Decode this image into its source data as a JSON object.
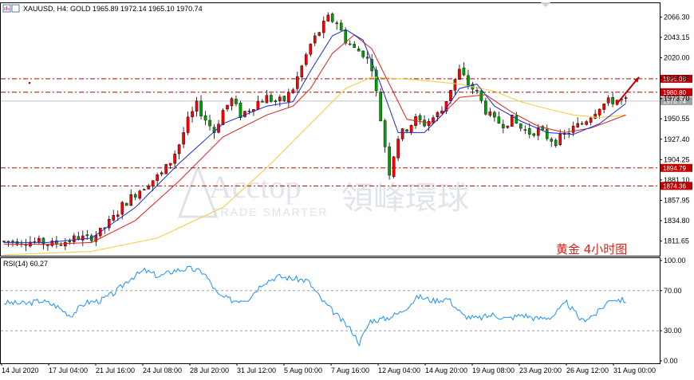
{
  "header": {
    "symbol_text": "XAUUSD, H4:  GOLD  1965.89 1972.14 1965.10 1970.74"
  },
  "caption": "黄金    4小时图",
  "watermark": {
    "brand": "Acctop",
    "tagline": "TRADE SMARTER",
    "chinese": "領峰環球"
  },
  "rsi_panel": {
    "title": "RSI(14) 60.27"
  },
  "colors": {
    "bull": "#ff0000",
    "bear": "#00a000",
    "wick": "#000000",
    "ma_fast": "#1a2ad6",
    "ma_mid": "#e0201a",
    "ma_slow": "#f0d048",
    "rsi": "#1e90ff",
    "level_line": "#c00000",
    "level_tag": "#c00000",
    "price_tag": "#a0a0a0"
  },
  "chart_data": [
    {
      "type": "candlestick",
      "title": "XAUUSD, H4",
      "ylim": [
        1795,
        2082
      ],
      "y_ticks": [
        "2066.30",
        "2043.15",
        "2020.00",
        "1996.85",
        "1973.70",
        "1950.55",
        "1927.40",
        "1904.25",
        "1881.10",
        "1857.95",
        "1834.80",
        "1811.65"
      ],
      "x_ticks": [
        "14 Jul 2020",
        "17 Jul 04:00",
        "21 Jul 16:00",
        "24 Jul 08:00",
        "28 Jul 20:00",
        "31 Jul 12:00",
        "5 Aug 00:00",
        "7 Aug 16:00",
        "12 Aug 04:00",
        "14 Aug 20:00",
        "19 Aug 08:00",
        "23 Aug 20:00",
        "26 Aug 12:00",
        "31 Aug 00:00"
      ],
      "levels": [
        {
          "value": 1996.08,
          "label": "1996.08"
        },
        {
          "value": 1980.8,
          "label": "1980.80"
        },
        {
          "value": 1894.79,
          "label": "1894.79"
        },
        {
          "value": 1874.36,
          "label": "1874.36"
        }
      ],
      "current_price": {
        "value": 1970.74,
        "label": "1970.74"
      },
      "price_path": [
        [
          0,
          1811
        ],
        [
          4,
          1812
        ],
        [
          8,
          1810
        ],
        [
          11,
          1808
        ],
        [
          14,
          1811
        ],
        [
          17,
          1816
        ],
        [
          19,
          1814
        ],
        [
          22,
          1822
        ],
        [
          25,
          1838
        ],
        [
          27,
          1852
        ],
        [
          30,
          1866
        ],
        [
          33,
          1878
        ],
        [
          36,
          1888
        ],
        [
          38,
          1902
        ],
        [
          40,
          1922
        ],
        [
          42,
          1948
        ],
        [
          44,
          1966
        ],
        [
          46,
          1950
        ],
        [
          48,
          1936
        ],
        [
          50,
          1960
        ],
        [
          52,
          1972
        ],
        [
          54,
          1955
        ],
        [
          56,
          1962
        ],
        [
          58,
          1970
        ],
        [
          60,
          1975
        ],
        [
          62,
          1970
        ],
        [
          64,
          1972
        ],
        [
          66,
          1985
        ],
        [
          68,
          2010
        ],
        [
          70,
          2035
        ],
        [
          72,
          2050
        ],
        [
          74,
          2065
        ],
        [
          76,
          2060
        ],
        [
          78,
          2040
        ],
        [
          80,
          2030
        ],
        [
          82,
          2025
        ],
        [
          84,
          2010
        ],
        [
          85,
          1980
        ],
        [
          86,
          1950
        ],
        [
          87,
          1920
        ],
        [
          88,
          1890
        ],
        [
          89,
          1910
        ],
        [
          90,
          1930
        ],
        [
          92,
          1940
        ],
        [
          94,
          1950
        ],
        [
          96,
          1945
        ],
        [
          98,
          1952
        ],
        [
          100,
          1960
        ],
        [
          102,
          1985
        ],
        [
          104,
          2005
        ],
        [
          106,
          1990
        ],
        [
          108,
          1980
        ],
        [
          110,
          1960
        ],
        [
          112,
          1948
        ],
        [
          114,
          1945
        ],
        [
          116,
          1950
        ],
        [
          118,
          1940
        ],
        [
          120,
          1935
        ],
        [
          122,
          1938
        ],
        [
          124,
          1930
        ],
        [
          126,
          1925
        ],
        [
          128,
          1932
        ],
        [
          130,
          1940
        ],
        [
          132,
          1945
        ],
        [
          134,
          1955
        ],
        [
          136,
          1965
        ],
        [
          138,
          1970
        ],
        [
          140,
          1972
        ],
        [
          142,
          1971
        ]
      ],
      "ma_fast_path": [
        [
          0,
          1810
        ],
        [
          10,
          1810
        ],
        [
          20,
          1815
        ],
        [
          30,
          1850
        ],
        [
          40,
          1900
        ],
        [
          50,
          1945
        ],
        [
          60,
          1965
        ],
        [
          66,
          1970
        ],
        [
          70,
          2005
        ],
        [
          75,
          2045
        ],
        [
          78,
          2052
        ],
        [
          82,
          2040
        ],
        [
          86,
          1990
        ],
        [
          90,
          1935
        ],
        [
          96,
          1935
        ],
        [
          100,
          1955
        ],
        [
          104,
          1985
        ],
        [
          108,
          1990
        ],
        [
          112,
          1965
        ],
        [
          118,
          1948
        ],
        [
          124,
          1935
        ],
        [
          130,
          1933
        ],
        [
          136,
          1945
        ],
        [
          142,
          1968
        ]
      ],
      "ma_mid_path": [
        [
          0,
          1808
        ],
        [
          10,
          1808
        ],
        [
          20,
          1810
        ],
        [
          30,
          1835
        ],
        [
          40,
          1880
        ],
        [
          50,
          1930
        ],
        [
          60,
          1955
        ],
        [
          66,
          1965
        ],
        [
          70,
          1985
        ],
        [
          75,
          2025
        ],
        [
          80,
          2046
        ],
        [
          84,
          2030
        ],
        [
          88,
          1990
        ],
        [
          92,
          1950
        ],
        [
          98,
          1945
        ],
        [
          104,
          1975
        ],
        [
          110,
          1978
        ],
        [
          116,
          1958
        ],
        [
          122,
          1942
        ],
        [
          128,
          1935
        ],
        [
          134,
          1940
        ],
        [
          142,
          1955
        ]
      ],
      "ma_slow_path": [
        [
          0,
          1796
        ],
        [
          20,
          1800
        ],
        [
          35,
          1815
        ],
        [
          50,
          1850
        ],
        [
          60,
          1895
        ],
        [
          70,
          1945
        ],
        [
          78,
          1985
        ],
        [
          84,
          1998
        ],
        [
          94,
          1995
        ],
        [
          104,
          1990
        ],
        [
          112,
          1982
        ],
        [
          118,
          1970
        ],
        [
          124,
          1962
        ],
        [
          130,
          1955
        ],
        [
          136,
          1952
        ],
        [
          142,
          1955
        ]
      ],
      "arrow": {
        "from": [
          140,
          1968
        ],
        "to": [
          145,
          1998
        ]
      }
    },
    {
      "type": "line",
      "title": "RSI(14)",
      "ylim": [
        0,
        100
      ],
      "y_ticks": [
        "100.00",
        "70.00",
        "30.00",
        "0.00"
      ],
      "levels": [
        70,
        30
      ],
      "rsi_path": [
        [
          0,
          58
        ],
        [
          6,
          57
        ],
        [
          10,
          60
        ],
        [
          14,
          55
        ],
        [
          18,
          45
        ],
        [
          22,
          58
        ],
        [
          26,
          60
        ],
        [
          30,
          68
        ],
        [
          34,
          82
        ],
        [
          38,
          90
        ],
        [
          42,
          84
        ],
        [
          46,
          90
        ],
        [
          50,
          92
        ],
        [
          54,
          88
        ],
        [
          58,
          65
        ],
        [
          62,
          60
        ],
        [
          66,
          62
        ],
        [
          70,
          78
        ],
        [
          74,
          84
        ],
        [
          78,
          82
        ],
        [
          82,
          80
        ],
        [
          86,
          60
        ],
        [
          90,
          45
        ],
        [
          94,
          30
        ],
        [
          96,
          18
        ],
        [
          99,
          40
        ],
        [
          103,
          42
        ],
        [
          107,
          48
        ],
        [
          112,
          64
        ],
        [
          116,
          60
        ],
        [
          120,
          62
        ],
        [
          124,
          45
        ],
        [
          128,
          42
        ],
        [
          132,
          46
        ],
        [
          136,
          42
        ],
        [
          140,
          46
        ],
        [
          144,
          42
        ],
        [
          148,
          44
        ],
        [
          152,
          58
        ],
        [
          156,
          40
        ],
        [
          160,
          47
        ],
        [
          164,
          62
        ],
        [
          168,
          60
        ]
      ]
    }
  ]
}
